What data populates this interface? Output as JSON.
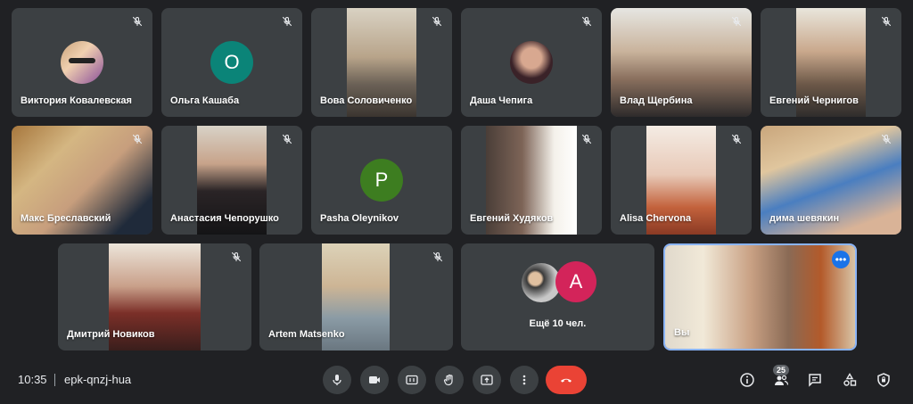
{
  "participants": [
    {
      "name": "Виктория Ковалевская",
      "type": "avatar-photo",
      "avatar_color": "#b57dc9"
    },
    {
      "name": "Ольга Кашаба",
      "type": "avatar-letter",
      "letter": "O",
      "avatar_color": "#0b8478"
    },
    {
      "name": "Вова Соловиченко",
      "type": "video"
    },
    {
      "name": "Даша Чепига",
      "type": "avatar-photo",
      "avatar_color": "#6b3b4b"
    },
    {
      "name": "Влад Щербина",
      "type": "video"
    },
    {
      "name": "Евгений Чернигов",
      "type": "video"
    },
    {
      "name": "Макс Бреславский",
      "type": "video"
    },
    {
      "name": "Анастасия Чепорушко",
      "type": "video"
    },
    {
      "name": "Pasha Oleynikov",
      "type": "avatar-letter",
      "letter": "P",
      "avatar_color": "#3d7d20"
    },
    {
      "name": "Евгений Худяков",
      "type": "video"
    },
    {
      "name": "Alisa Chervona",
      "type": "video"
    },
    {
      "name": "дима шевякин",
      "type": "video"
    },
    {
      "name": "Дмитрий Новиков",
      "type": "video"
    },
    {
      "name": "Artem Matsenko",
      "type": "video"
    }
  ],
  "others": {
    "label": "Ещё 10 чел.",
    "letter": "A",
    "avatar_color": "#d3245a"
  },
  "self": {
    "name": "Вы"
  },
  "bottombar": {
    "time": "10:35",
    "meeting_code": "epk-qnzj-hua",
    "people_count": "25"
  },
  "colors": {
    "accent": "#8ab4f8",
    "end_call": "#ea4335",
    "tile_bg": "#3c4043",
    "page_bg": "#202124"
  }
}
